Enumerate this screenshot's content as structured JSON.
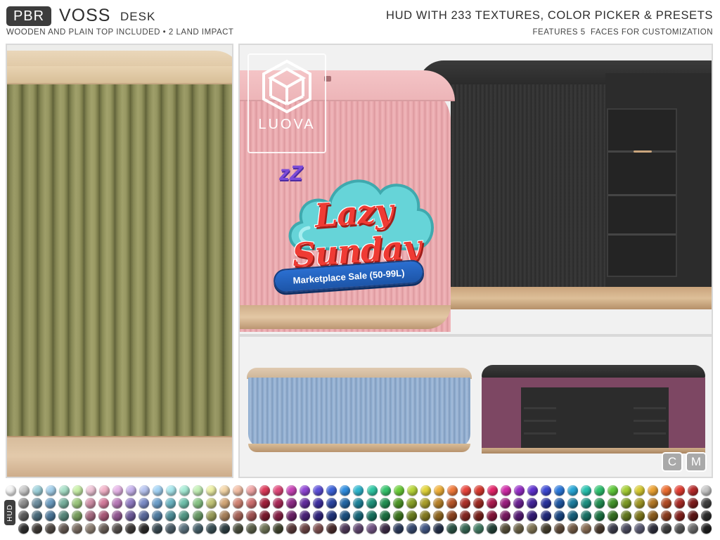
{
  "header": {
    "badge": "PBR",
    "product_name": "VOSS",
    "product_type": "DESK",
    "subtitle_left": "WOODEN AND PLAIN TOP INCLUDED • 2 LAND IMPACT",
    "headline_right": "HUD WITH 233 TEXTURES, COLOR PICKER & PRESETS",
    "subtitle_right": "FEATURES 5  FACES FOR CUSTOMIZATION"
  },
  "logo": {
    "text": "LUOVA",
    "icon": "luova-hexagon-logo"
  },
  "sale": {
    "zz": "zZ",
    "title": "Lazy Sunday",
    "pill": "Marketplace Sale (50-99L)",
    "colors": {
      "cloud": "#66d4d8",
      "title": "#ef3b34",
      "pill": "#2b6fd1"
    }
  },
  "buttons": {
    "c_label": "C",
    "m_label": "M"
  },
  "hud": {
    "label": "HUD",
    "rows": [
      [
        "#f5f5f5",
        "#c9c9c9",
        "#9fd2dc",
        "#a5d1ec",
        "#a8e0c8",
        "#c9f0a8",
        "#f0c6d8",
        "#f3b2c8",
        "#e7b5e8",
        "#c8b4ee",
        "#b7c4f0",
        "#a4d4f6",
        "#a9e8ee",
        "#a6ecd6",
        "#c3f0b6",
        "#eef0a6",
        "#f5d7a8",
        "#f3bfa6",
        "#f1a6a6",
        "#dd3a5a",
        "#e0497b",
        "#c944b7",
        "#8f45d4",
        "#5d4fd9",
        "#3d63da",
        "#2f8de0",
        "#2fb7cf",
        "#2fc8a4",
        "#36c56d",
        "#6ccf3a",
        "#b8d63a",
        "#e3d53a",
        "#f1b13a",
        "#f17a3a",
        "#e9453d",
        "#d83a2f",
        "#e5256a",
        "#d02ba7",
        "#962dc7",
        "#5f31cf",
        "#3d49d4",
        "#2b79dc",
        "#27a7d7",
        "#28c3b0",
        "#2ec270",
        "#5fc83b",
        "#a6cf36",
        "#d8cb33",
        "#eca232",
        "#ed6e31",
        "#e33d31",
        "#b52a2a",
        "#c6c6c6"
      ],
      [
        "#8e8e8e",
        "#6f8fa0",
        "#6b9cc0",
        "#78b09d",
        "#9cc77d",
        "#cf8fa7",
        "#d27a9a",
        "#b87ab8",
        "#8f7bc2",
        "#7a8bc6",
        "#6d9fca",
        "#6ab4c2",
        "#6fc0ab",
        "#88c485",
        "#c2c578",
        "#d2a677",
        "#d18474",
        "#cc6e6e",
        "#a0203a",
        "#a92a58",
        "#8c2b85",
        "#612c9c",
        "#3e2f9f",
        "#2a44a0",
        "#2266a4",
        "#1f8399",
        "#1f917a",
        "#239052",
        "#4e9628",
        "#88a028",
        "#aa9f2a",
        "#b7822a",
        "#b55528",
        "#ad312a",
        "#9c2a22",
        "#aa1a4e",
        "#9a1f7e",
        "#6a2191",
        "#432498",
        "#29339c",
        "#1f57a2",
        "#1d7d9e",
        "#1e9182",
        "#228f52",
        "#44932b",
        "#7d9a26",
        "#a09725",
        "#b27725",
        "#b14b24",
        "#a72a24",
        "#7d1c1c",
        "#3f3f3f"
      ],
      [
        "#5a5a5a",
        "#4a6a7a",
        "#4a7596",
        "#57877a",
        "#779d5d",
        "#a56a80",
        "#a85877",
        "#915891",
        "#6c5a98",
        "#5a699c",
        "#4f7ba0",
        "#4e8e98",
        "#539886",
        "#699a66",
        "#9a9d5a",
        "#a7815a",
        "#a56358",
        "#9f5252",
        "#7a1a2d",
        "#821f43",
        "#6a2166",
        "#4a2178",
        "#2f237a",
        "#20347b",
        "#1a4f7f",
        "#186577",
        "#18715e",
        "#1b6f40",
        "#3c741f",
        "#6a7c1f",
        "#837a20",
        "#8d6520",
        "#8b421f",
        "#842620",
        "#75201a",
        "#841439",
        "#771760",
        "#521970",
        "#331b76",
        "#1f2879",
        "#18447f",
        "#175f7b",
        "#187064",
        "#1a6f40",
        "#346f20",
        "#61771d",
        "#7c751c",
        "#8a5c1d",
        "#883a1c",
        "#811f1b",
        "#5c1515",
        "#2a2a2a"
      ],
      [
        "#2f2f2f",
        "#3f3a36",
        "#514a45",
        "#665a53",
        "#7a6d62",
        "#8e8074",
        "#6a5f58",
        "#56504d",
        "#3e3a38",
        "#2d2b2a",
        "#3a4a52",
        "#4b5d68",
        "#5b727e",
        "#46606a",
        "#3a5056",
        "#2f4044",
        "#4b4f3e",
        "#5c614a",
        "#6e7456",
        "#41452f",
        "#5a3a3a",
        "#6d4545",
        "#7f5050",
        "#4b2d2d",
        "#503a5a",
        "#614770",
        "#725484",
        "#3e2d48",
        "#2c3b5c",
        "#37496f",
        "#425784",
        "#243049",
        "#2c5446",
        "#376855",
        "#427c64",
        "#234338",
        "#57503a",
        "#6b6247",
        "#7f7454",
        "#443e2d",
        "#5e4a39",
        "#735b46",
        "#886c53",
        "#4a3a2d",
        "#3d3d4d",
        "#4b4b5f",
        "#5a5a72",
        "#30303e",
        "#404040",
        "#555555",
        "#6a6a6a",
        "#1e1e1e"
      ]
    ]
  }
}
